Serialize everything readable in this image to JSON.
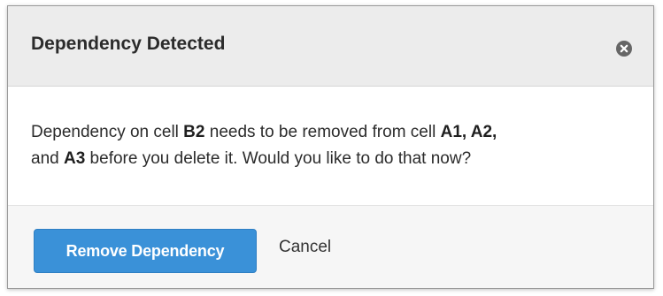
{
  "dialog": {
    "title": "Dependency Detected",
    "close_icon": "close-circle-icon",
    "message": {
      "part1": "Dependency on cell ",
      "source_cell": "B2",
      "part2": " needs to be removed from cell ",
      "target_cells": "A1, A2,",
      "part3": " and ",
      "last_cell": "A3",
      "part4": " before you delete it. Would you like to do that now?"
    },
    "primary_button": "Remove Dependency",
    "cancel_button": "Cancel"
  },
  "colors": {
    "header_bg": "#ececec",
    "primary": "#3a91d8",
    "footer_bg": "#f6f6f6",
    "text": "#2b2b2b"
  }
}
